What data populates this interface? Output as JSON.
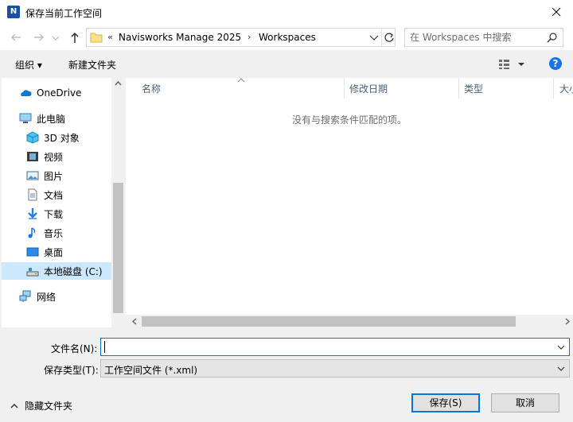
{
  "window": {
    "title": "保存当前工作空间",
    "app_icon_letter": "N"
  },
  "address": {
    "overflow": "«",
    "crumbs": [
      "Navisworks Manage 2025",
      "Workspaces"
    ]
  },
  "search": {
    "placeholder": "在 Workspaces 中搜索"
  },
  "toolbar": {
    "organize_label": "组织 ▾",
    "new_folder_label": "新建文件夹",
    "help_label": "?"
  },
  "sidebar": {
    "items": [
      {
        "label": "OneDrive",
        "icon": "cloud-icon"
      },
      {
        "label": "此电脑",
        "icon": "computer-icon"
      },
      {
        "label": "3D 对象",
        "icon": "cube-icon"
      },
      {
        "label": "视频",
        "icon": "video-icon"
      },
      {
        "label": "图片",
        "icon": "picture-icon"
      },
      {
        "label": "文档",
        "icon": "document-icon"
      },
      {
        "label": "下载",
        "icon": "download-icon"
      },
      {
        "label": "音乐",
        "icon": "music-icon"
      },
      {
        "label": "桌面",
        "icon": "desktop-icon"
      },
      {
        "label": "本地磁盘 (C:)",
        "icon": "drive-icon"
      },
      {
        "label": "网络",
        "icon": "network-icon"
      }
    ]
  },
  "filelist": {
    "columns": [
      "名称",
      "修改日期",
      "类型",
      "大小"
    ],
    "empty_message": "没有与搜索条件匹配的项。"
  },
  "form": {
    "filename_label": "文件名(N):",
    "filename_value": "",
    "filetype_label": "保存类型(T):",
    "filetype_value": "工作空间文件 (*.xml)"
  },
  "footer": {
    "hide_folders_label": "隐藏文件夹",
    "save_label": "保存(S)",
    "cancel_label": "取消"
  },
  "colors": {
    "accent": "#0078d7",
    "selection": "#cce8ff",
    "header_text": "#4c607a"
  }
}
